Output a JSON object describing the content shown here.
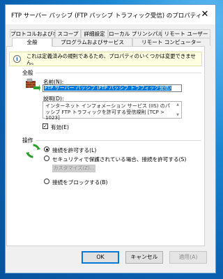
{
  "window": {
    "title": "FTP サーバー パッシブ (FTP パッシブ トラフィック受信) のプロパティ",
    "close_symbol": "✕"
  },
  "tabs": {
    "row1": [
      "プロトコルおよびポート",
      "スコープ",
      "詳細設定",
      "ローカル プリンシパル",
      "リモート ユーザー"
    ],
    "row2": [
      "全般",
      "プログラムおよびサービス",
      "リモート コンピューター"
    ],
    "selected": "全般"
  },
  "notice": {
    "icon": "info-icon",
    "icon_glyph": "i",
    "text": "これは定義済みの規則であるため、プロパティのいくつかは変更できません。"
  },
  "general": {
    "group_label": "全般",
    "name_label": "名前(N):",
    "name_value": "FTP サーバー パッシブ (FTP パッシブ トラフィック受信)",
    "desc_label": "説明(D):",
    "desc_value": "インターネット インフォメーション サービス (IIS) のパッシブ FTP トラフィックを許可する受信規則 [TCP > 1023]",
    "enabled_label": "有効(E)",
    "enabled_checked": true,
    "check_glyph": "✓",
    "scroll_up_glyph": "▲",
    "scroll_down_glyph": "▼"
  },
  "action": {
    "group_label": "操作",
    "options": [
      {
        "label": "接続を許可する(L)",
        "selected": true
      },
      {
        "label": "セキュリティで保護されている場合、接続を許可する(S)",
        "selected": false
      },
      {
        "label": "接続をブロックする(B)",
        "selected": false
      }
    ],
    "customize_label": "カスタマイズ(Z)..."
  },
  "buttons": {
    "ok": "OK",
    "cancel": "キャンセル",
    "apply": "適用(A)"
  },
  "colors": {
    "accent": "#0078d7",
    "notice_bg": "#ffffe1"
  }
}
